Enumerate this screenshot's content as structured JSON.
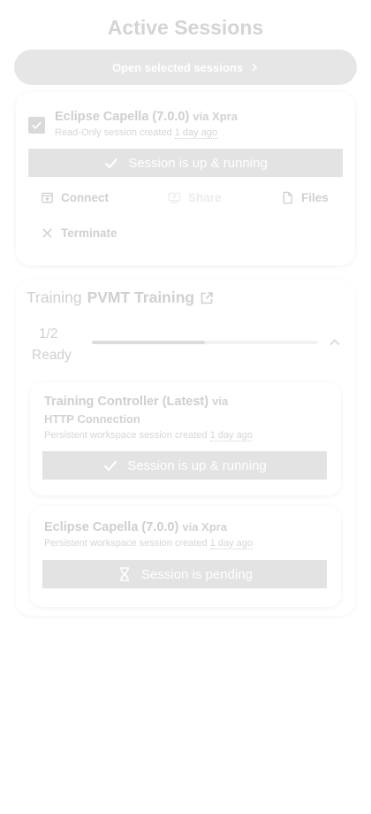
{
  "page": {
    "title": "Active Sessions"
  },
  "open_selected": {
    "label": "Open selected sessions"
  },
  "session_1": {
    "title": "Eclipse Capella (7.0.0)",
    "via": "via Xpra",
    "subtitle_prefix": "Read-Only session created",
    "created_ago": "1 day ago",
    "selected": true,
    "status": "Session is up & running",
    "actions": {
      "connect": "Connect",
      "share": "Share",
      "files": "Files",
      "terminate": "Terminate"
    }
  },
  "training": {
    "prefix": "Training",
    "name": "PVMT Training",
    "progress": {
      "count": "1/2",
      "label": "Ready",
      "fraction": 0.5
    },
    "sessions": [
      {
        "title": "Training Controller (Latest)",
        "via": "via HTTP Connection",
        "subtitle_prefix": "Persistent workspace session created",
        "created_ago": "1 day ago",
        "status": "Session is up & running"
      },
      {
        "title": "Eclipse Capella (7.0.0)",
        "via": "via Xpra",
        "subtitle_prefix": "Persistent workspace session created",
        "created_ago": "1 day ago",
        "status": "Session is pending"
      }
    ]
  },
  "colors": {
    "status_bg": "#e3e3e3",
    "text_muted": "#d0d0d0",
    "button_bg": "#e6e6e6"
  },
  "icons": {
    "open_selected": "chevron-right-icon",
    "checkbox": "check-icon",
    "running": "check-icon",
    "pending": "hourglass-icon",
    "connect": "open-in-browser-icon",
    "share": "screen-share-icon",
    "files": "file-icon",
    "terminate": "close-icon",
    "training_link": "open-in-new-icon",
    "collapse": "chevron-up-icon"
  }
}
